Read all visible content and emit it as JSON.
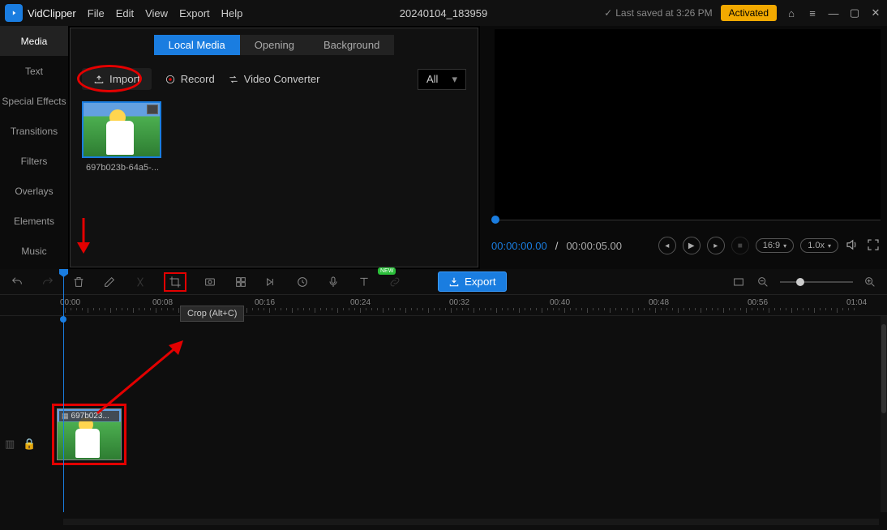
{
  "app": {
    "name": "VidClipper",
    "project": "20240104_183959"
  },
  "menu": [
    "File",
    "Edit",
    "View",
    "Export",
    "Help"
  ],
  "header": {
    "last_saved": "Last saved at 3:26 PM",
    "activated": "Activated"
  },
  "sidebar": {
    "items": [
      {
        "label": "Media"
      },
      {
        "label": "Text"
      },
      {
        "label": "Special Effects"
      },
      {
        "label": "Transitions"
      },
      {
        "label": "Filters"
      },
      {
        "label": "Overlays"
      },
      {
        "label": "Elements"
      },
      {
        "label": "Music"
      }
    ]
  },
  "media_tabs": [
    {
      "label": "Local Media"
    },
    {
      "label": "Opening"
    },
    {
      "label": "Background"
    }
  ],
  "media_toolbar": {
    "import": "Import",
    "record": "Record",
    "video_converter": "Video Converter",
    "filter": "All"
  },
  "media_item": {
    "name": "697b023b-64a5-..."
  },
  "preview": {
    "current": "00:00:00.00",
    "sep": " / ",
    "total": "00:00:05.00",
    "aspect": "16:9",
    "speed": "1.0x"
  },
  "timeline": {
    "export": "Export",
    "new": "NEW",
    "tooltip": "Crop (Alt+C)",
    "ruler": [
      "00:00",
      "00:08",
      "00:16",
      "00:24",
      "00:32",
      "00:40",
      "00:48",
      "00:56",
      "01:04"
    ],
    "clip_label": "697b023..."
  }
}
